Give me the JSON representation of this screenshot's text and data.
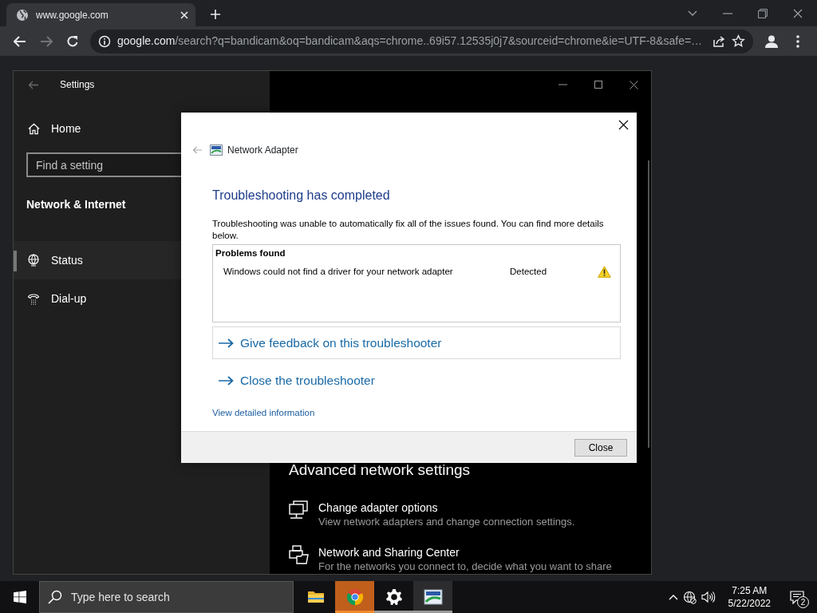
{
  "browser": {
    "tab_title": "www.google.com",
    "forward_disabled": true,
    "address_host": "google.com",
    "address_path": "/search?q=bandicam&oq=bandicam&aqs=chrome..69i57.12535j0j7&sourceid=chrome&ie=UTF-8&safe=…"
  },
  "settings": {
    "title": "Settings",
    "home": "Home",
    "search": {
      "placeholder": "Find a setting"
    },
    "section": "Network & Internet",
    "nav": [
      {
        "label": "Status",
        "selected": true
      },
      {
        "label": "Dial-up",
        "selected": false
      }
    ],
    "heading": "Advanced network settings",
    "options": [
      {
        "title": "Change adapter options",
        "description": "View network adapters and change connection settings."
      },
      {
        "title": "Network and Sharing Center",
        "description": "For the networks you connect to, decide what you want to share"
      }
    ]
  },
  "dialog": {
    "app": "Network Adapter",
    "heading": "Troubleshooting has completed",
    "message": "Troubleshooting was unable to automatically fix all of the issues found. You can find more details below.",
    "problems": {
      "header": "Problems found",
      "rows": [
        {
          "problem": "Windows could not find a driver for your network adapter",
          "status": "Detected"
        }
      ]
    },
    "actions": [
      {
        "label": "Give feedback on this troubleshooter",
        "focused": true
      },
      {
        "label": "Close the troubleshooter",
        "focused": false
      }
    ],
    "details_link": "View detailed information",
    "close_button": "Close"
  },
  "taskbar": {
    "search": {
      "placeholder": "Type here to search"
    },
    "apps": [
      {
        "highlighted": false,
        "running": false
      },
      {
        "highlighted": true,
        "running": true
      },
      {
        "highlighted": false,
        "running": true
      },
      {
        "highlighted": false,
        "running": true
      }
    ],
    "time": "7:25 AM",
    "date": "5/22/2022",
    "notifications": "2"
  }
}
